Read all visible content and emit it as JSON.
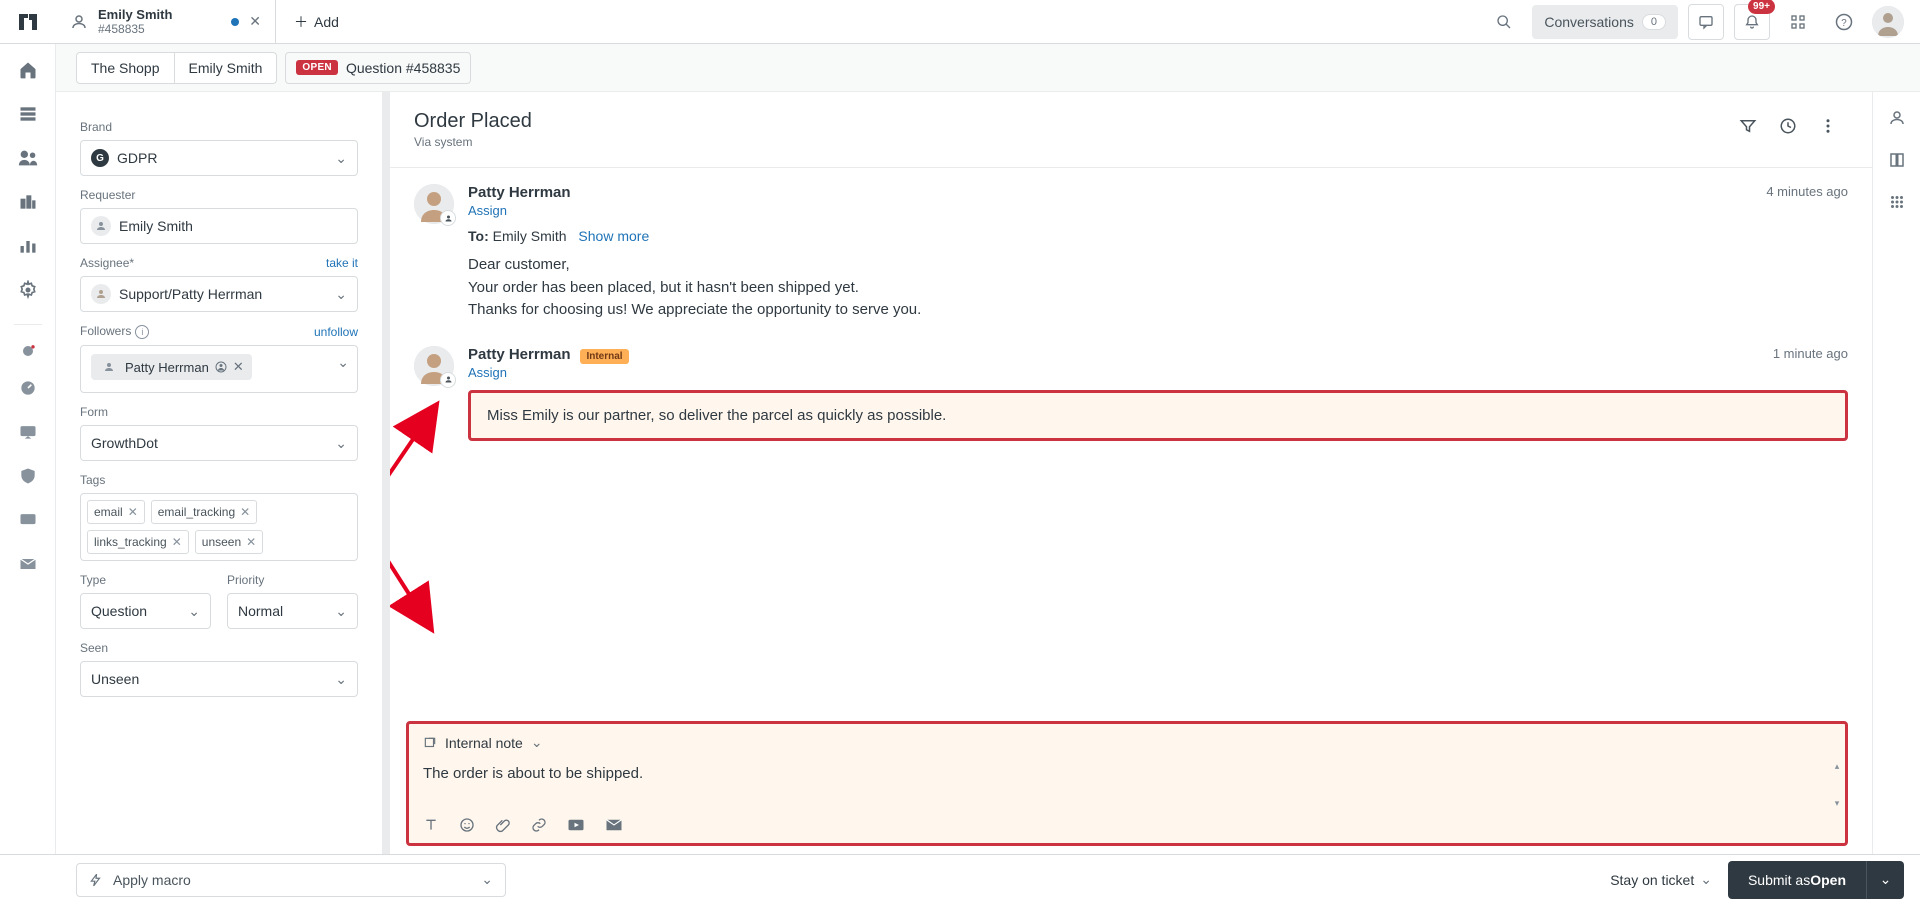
{
  "top": {
    "tab_title": "Emily Smith",
    "tab_sub": "#458835",
    "add_label": "Add",
    "conversations_label": "Conversations",
    "conversations_count": "0",
    "notif_count": "99+"
  },
  "breadcrumb": {
    "org": "The Shopp",
    "user": "Emily Smith",
    "status_badge": "OPEN",
    "ticket_label": "Question #458835"
  },
  "sidebar": {
    "brand_label": "Brand",
    "brand_value": "GDPR",
    "requester_label": "Requester",
    "requester_value": "Emily Smith",
    "assignee_label": "Assignee*",
    "assignee_link": "take it",
    "assignee_value": "Support/Patty Herrman",
    "followers_label": "Followers",
    "followers_link": "unfollow",
    "follower_name": "Patty Herrman",
    "form_label": "Form",
    "form_value": "GrowthDot",
    "tags_label": "Tags",
    "tags": [
      "email",
      "email_tracking",
      "links_tracking",
      "unseen"
    ],
    "type_label": "Type",
    "type_value": "Question",
    "priority_label": "Priority",
    "priority_value": "Normal",
    "seen_label": "Seen",
    "seen_value": "Unseen"
  },
  "convo": {
    "title": "Order Placed",
    "via": "Via system",
    "msg1": {
      "author": "Patty Herrman",
      "time": "4 minutes ago",
      "assign": "Assign",
      "to_label": "To:",
      "to_name": "Emily Smith",
      "show_more": "Show more",
      "line1": "Dear customer,",
      "line2": "Your order has been placed, but it hasn't been shipped yet.",
      "line3": "Thanks for choosing us! We appreciate the opportunity to serve you."
    },
    "msg2": {
      "author": "Patty Herrman",
      "badge": "Internal",
      "time": "1 minute ago",
      "assign": "Assign",
      "note": "Miss Emily is our partner, so deliver the parcel as quickly as possible."
    },
    "composer": {
      "mode": "Internal note",
      "text": "The order is about to be shipped."
    }
  },
  "footer": {
    "macro_label": "Apply macro",
    "stay_label": "Stay on ticket",
    "submit_prefix": "Submit as ",
    "submit_status": "Open"
  }
}
